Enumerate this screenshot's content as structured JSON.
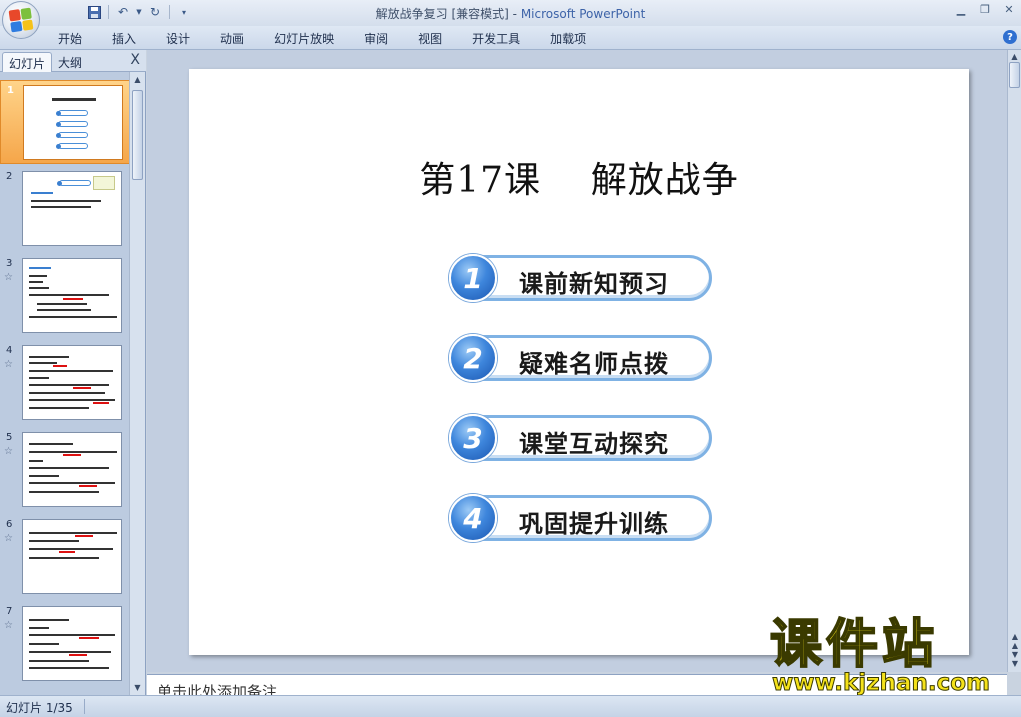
{
  "window": {
    "doc_title": "解放战争复习 [兼容模式] - ",
    "app_name": "Microsoft PowerPoint"
  },
  "qat": {
    "save_icon": "save-icon",
    "undo_icon": "undo-icon",
    "redo_icon": "redo-icon",
    "customize_icon": "customize-qat-icon"
  },
  "ribbon": {
    "tabs": [
      "开始",
      "插入",
      "设计",
      "动画",
      "幻灯片放映",
      "审阅",
      "视图",
      "开发工具",
      "加载项"
    ],
    "help_label": "?"
  },
  "panel": {
    "tab_slides": "幻灯片",
    "tab_outline": "大纲",
    "close_label": "X",
    "thumbnails": [
      {
        "num": "1",
        "star": ""
      },
      {
        "num": "2",
        "star": ""
      },
      {
        "num": "3",
        "star": "☆"
      },
      {
        "num": "4",
        "star": "☆"
      },
      {
        "num": "5",
        "star": "☆"
      },
      {
        "num": "6",
        "star": "☆"
      },
      {
        "num": "7",
        "star": "☆"
      }
    ]
  },
  "slide": {
    "title": "第17课    解放战争",
    "menu": [
      {
        "num": "1",
        "label": "课前新知预习"
      },
      {
        "num": "2",
        "label": "疑难名师点拨"
      },
      {
        "num": "3",
        "label": "课堂互动探究"
      },
      {
        "num": "4",
        "label": "巩固提升训练"
      }
    ]
  },
  "notes": {
    "placeholder": "单击此处添加备注"
  },
  "watermark": {
    "title": "课件站",
    "url": "www.kjzhan.com"
  },
  "status": {
    "slide_counter": "幻灯片 1/35"
  },
  "colors": {
    "accent_blue": "#3e86dc",
    "selected_orange": "#f5a64a",
    "watermark_yellow": "#f5e21a"
  }
}
